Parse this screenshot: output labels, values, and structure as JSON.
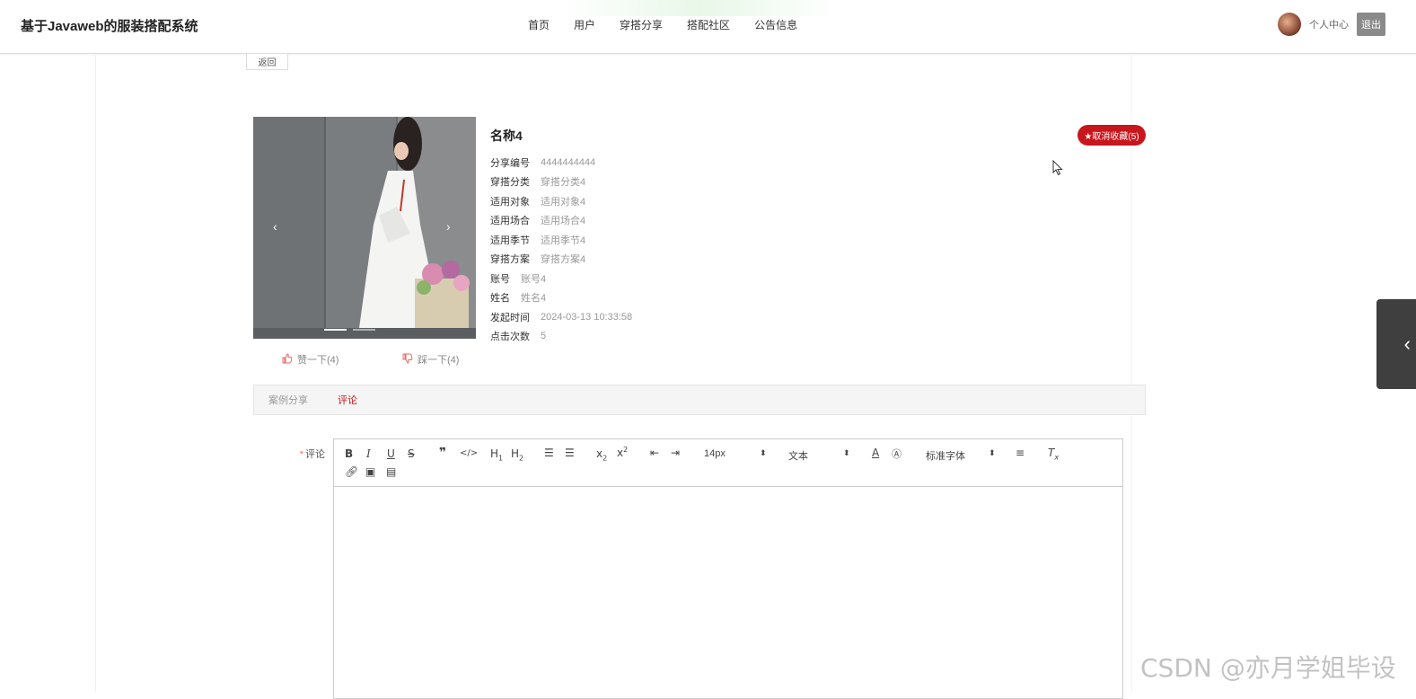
{
  "header": {
    "logo": "基于Javaweb的服装搭配系统",
    "nav": [
      "首页",
      "用户",
      "穿搭分享",
      "搭配社区",
      "公告信息"
    ],
    "user_center": "个人中心",
    "logout": "退出"
  },
  "back_label": "返回",
  "detail": {
    "title": "名称4",
    "favorite_label": "★取消收藏(5)",
    "fields": [
      {
        "k": "分享编号",
        "v": "4444444444"
      },
      {
        "k": "穿搭分类",
        "v": "穿搭分类4"
      },
      {
        "k": "适用对象",
        "v": "适用对象4"
      },
      {
        "k": "适用场合",
        "v": "适用场合4"
      },
      {
        "k": "适用季节",
        "v": "适用季节4"
      },
      {
        "k": "穿搭方案",
        "v": "穿搭方案4"
      },
      {
        "k": "账号",
        "v": "账号4"
      },
      {
        "k": "姓名",
        "v": "姓名4"
      },
      {
        "k": "发起时间",
        "v": "2024-03-13 10:33:58"
      },
      {
        "k": "点击次数",
        "v": "5"
      }
    ],
    "like_label": "赞一下(4)",
    "dislike_label": "踩一下(4)"
  },
  "tabs": [
    {
      "label": "案例分享",
      "active": false
    },
    {
      "label": "评论",
      "active": true
    }
  ],
  "comment": {
    "label": "评论",
    "required_mark": "*",
    "font_size": "14px",
    "block_type": "文本",
    "font_family": "标准字体"
  },
  "watermark": "CSDN @亦月学姐毕设",
  "colors": {
    "accent": "#c8161d",
    "tab_bg": "#f6f5f5",
    "logout_bg": "#8a8a8a"
  }
}
